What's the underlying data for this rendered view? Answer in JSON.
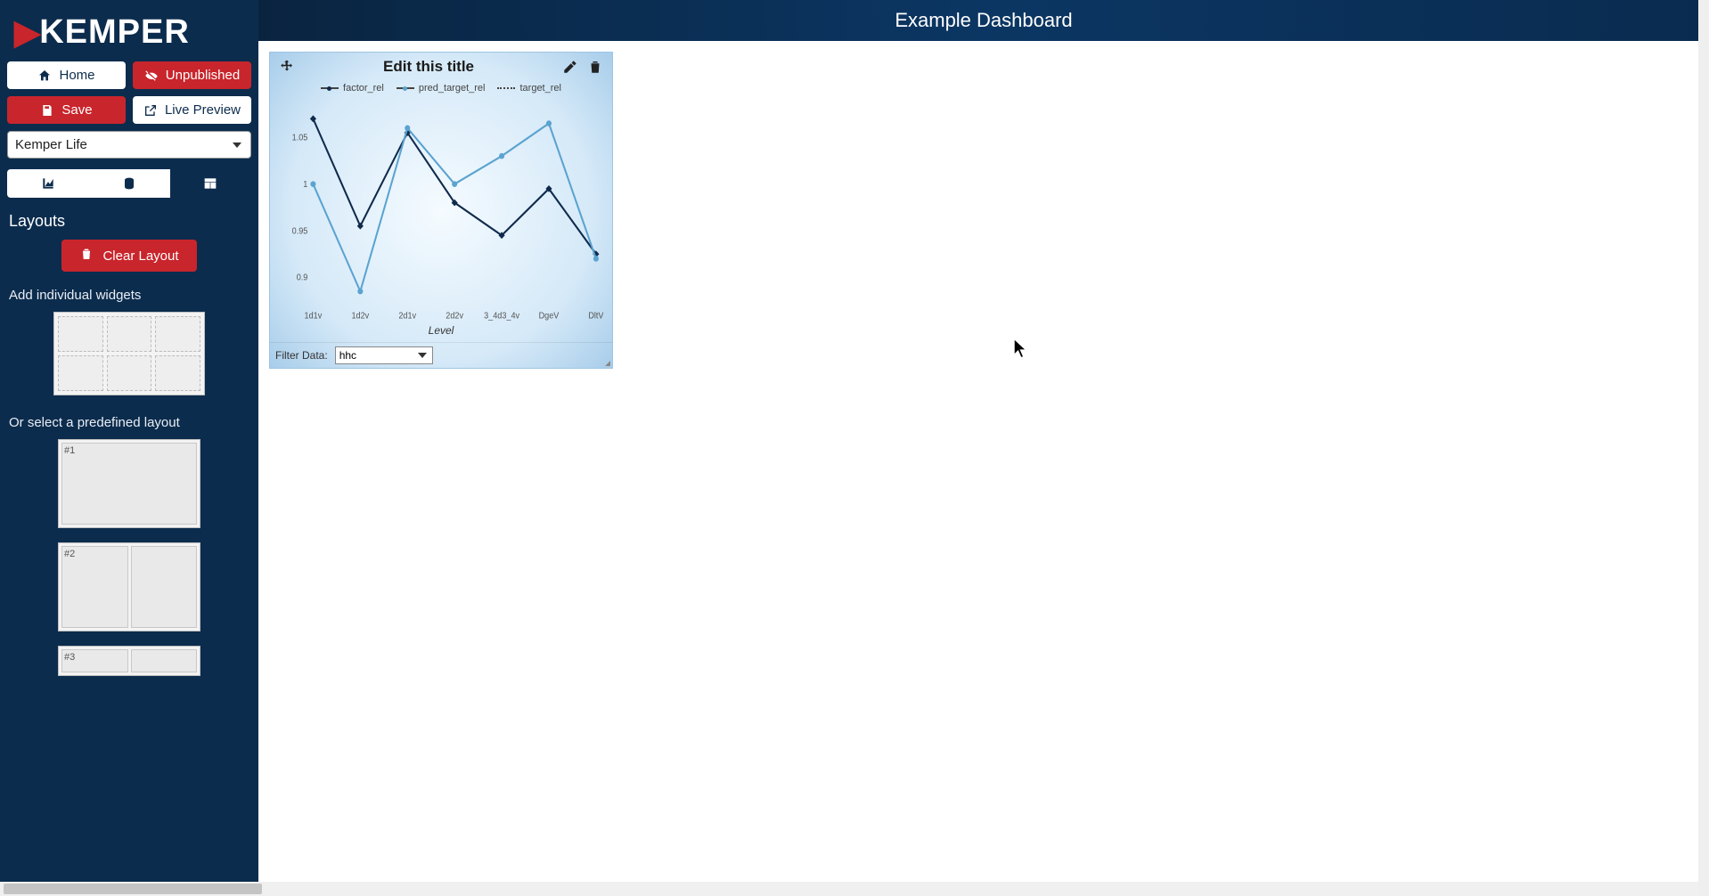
{
  "brand": {
    "name": "KEMPER"
  },
  "sidebar": {
    "home_label": "Home",
    "unpublished_label": "Unpublished",
    "save_label": "Save",
    "live_preview_label": "Live Preview",
    "project_select_value": "Kemper Life",
    "layouts_heading": "Layouts",
    "clear_layout_label": "Clear Layout",
    "add_widgets_label": "Add individual widgets",
    "predefined_label": "Or select a predefined layout",
    "predef": [
      "#1",
      "#2",
      "#3"
    ]
  },
  "header": {
    "title": "Example Dashboard"
  },
  "widget": {
    "title": "Edit this title",
    "filter_label": "Filter Data:",
    "filter_value": "hhc",
    "xlabel": "Level"
  },
  "chart_data": {
    "type": "line",
    "title": "Edit this title",
    "xlabel": "Level",
    "ylabel": "",
    "ylim": [
      0.875,
      1.085
    ],
    "yticks": [
      0.9,
      0.95,
      1.0,
      1.05
    ],
    "categories": [
      "1d1v",
      "1d2v",
      "2d1v",
      "2d2v",
      "3_4d3_4v",
      "DgeV",
      "DltV"
    ],
    "series": [
      {
        "name": "factor_rel",
        "color": "#102a4c",
        "style": "solid",
        "values": [
          1.07,
          0.955,
          1.055,
          0.98,
          0.945,
          0.995,
          0.925
        ]
      },
      {
        "name": "pred_target_rel",
        "color": "#5ba3d0",
        "style": "solid",
        "values": [
          1.0,
          0.885,
          1.06,
          1.0,
          1.03,
          1.065,
          0.92
        ]
      },
      {
        "name": "target_rel",
        "color": "#8aa7bd",
        "style": "dotted",
        "values": [
          null,
          null,
          null,
          null,
          null,
          null,
          null
        ]
      }
    ]
  }
}
